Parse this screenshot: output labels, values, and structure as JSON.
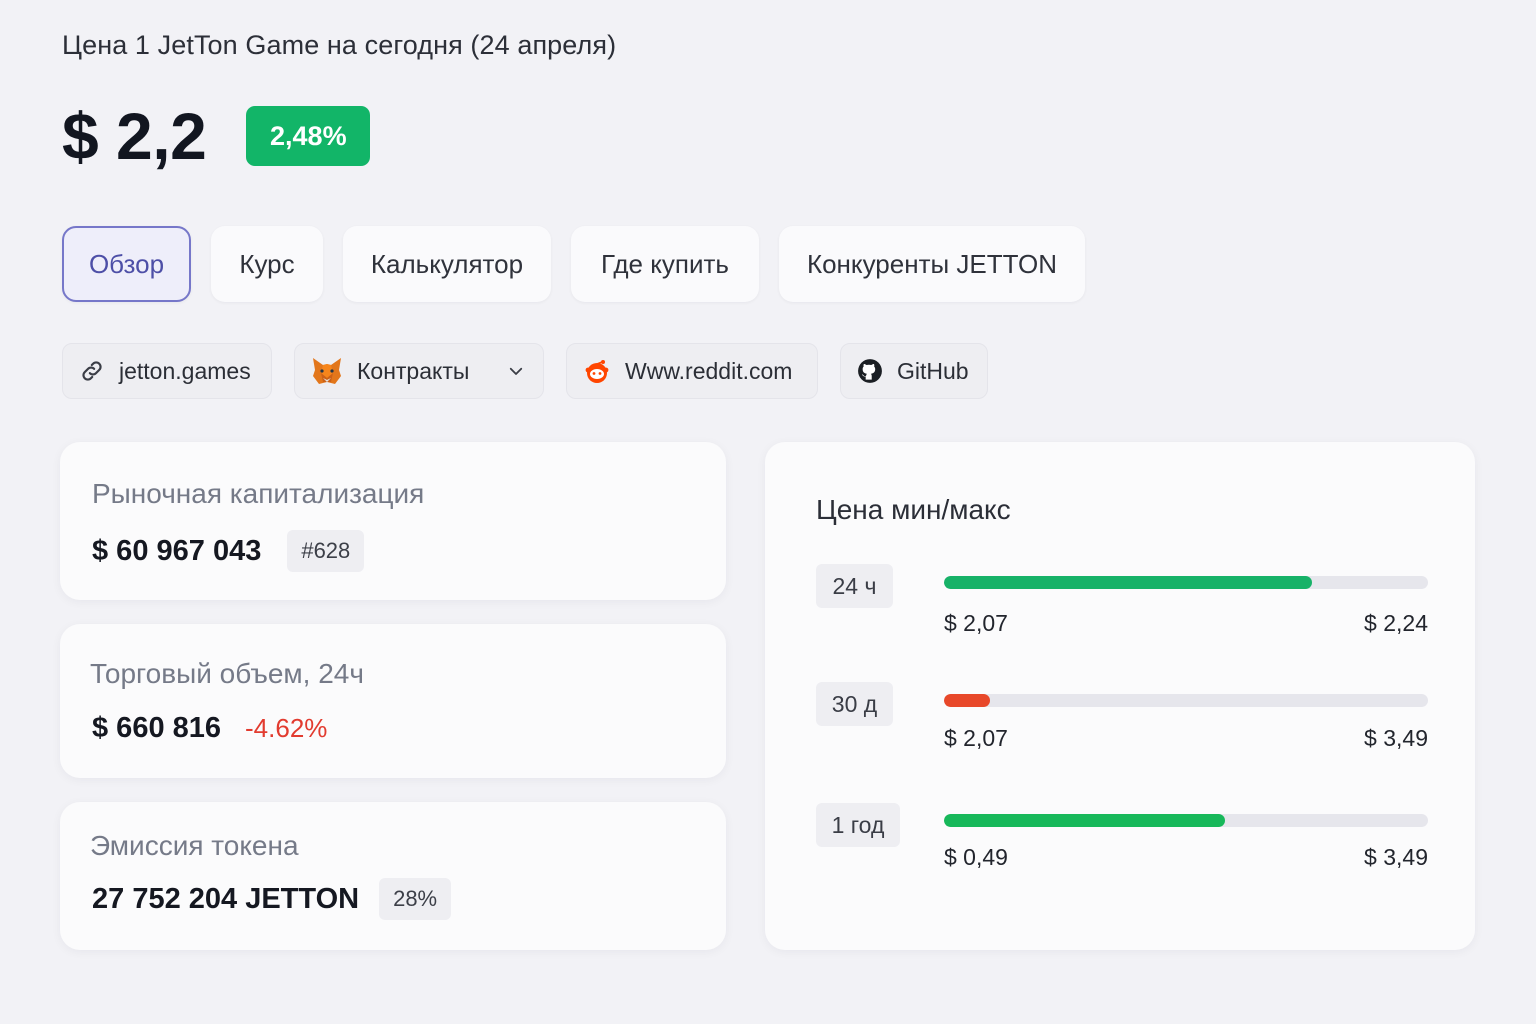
{
  "header": {
    "title": "Цена 1 JetTon Game на сегодня (24 апреля)",
    "price": "$ 2,2",
    "change": "2,48%",
    "change_color": "#12b568"
  },
  "tabs": [
    {
      "label": "Обзор",
      "active": true
    },
    {
      "label": "Курс",
      "active": false
    },
    {
      "label": "Калькулятор",
      "active": false
    },
    {
      "label": "Где купить",
      "active": false
    },
    {
      "label": "Конкуренты JETTON",
      "active": false
    }
  ],
  "links": [
    {
      "label": "jetton.games",
      "icon": "link-icon"
    },
    {
      "label": "Контракты",
      "icon": "metamask-fox-icon",
      "dropdown": true
    },
    {
      "label": "Www.reddit.com",
      "icon": "reddit-icon"
    },
    {
      "label": "GitHub",
      "icon": "github-icon"
    }
  ],
  "stats": {
    "market_cap": {
      "label": "Рыночная капитализация",
      "value": "$ 60 967 043",
      "rank": "#628"
    },
    "volume": {
      "label": "Торговый объем, 24ч",
      "value": "$ 660 816",
      "change": "-4.62%"
    },
    "supply": {
      "label": "Эмиссия токена",
      "value": "27 752 204 JETTON",
      "percent": "28%"
    }
  },
  "price_range": {
    "title": "Цена мин/макс",
    "rows": [
      {
        "period": "24 ч",
        "min": "$ 2,07",
        "max": "$ 2,24",
        "fill_fraction": 0.76,
        "color": "#17b268"
      },
      {
        "period": "30 д",
        "min": "$ 2,07",
        "max": "$ 3,49",
        "fill_fraction": 0.095,
        "color": "#e8482a"
      },
      {
        "period": "1 год",
        "min": "$ 0,49",
        "max": "$ 3,49",
        "fill_fraction": 0.58,
        "color": "#17b85a"
      }
    ]
  }
}
